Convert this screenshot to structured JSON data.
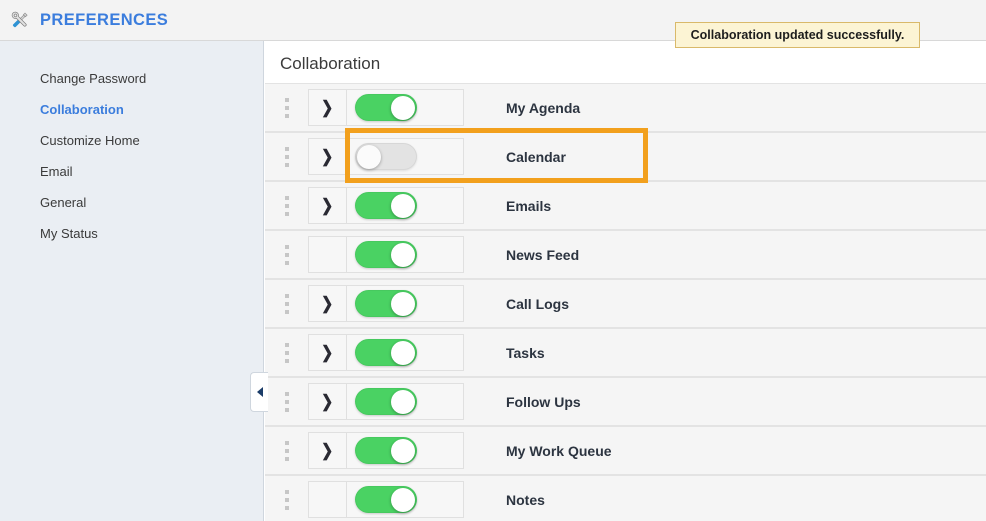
{
  "header": {
    "title": "PREFERENCES",
    "icon": "tools-icon"
  },
  "toast": {
    "message": "Collaboration updated successfully.",
    "background": "#fcf4d4",
    "border_color": "#d9b96a"
  },
  "sidebar": {
    "items": [
      {
        "label": "Change Password",
        "active": false
      },
      {
        "label": "Collaboration",
        "active": true
      },
      {
        "label": "Customize Home",
        "active": false
      },
      {
        "label": "Email",
        "active": false
      },
      {
        "label": "General",
        "active": false
      },
      {
        "label": "My Status",
        "active": false
      }
    ],
    "collapse_handle_icon": "chevron-left-icon"
  },
  "main": {
    "section_title": "Collaboration",
    "rows": [
      {
        "label": "My Agenda",
        "enabled": true,
        "has_expander": true,
        "highlighted": false
      },
      {
        "label": "Calendar",
        "enabled": false,
        "has_expander": true,
        "highlighted": true
      },
      {
        "label": "Emails",
        "enabled": true,
        "has_expander": true,
        "highlighted": false
      },
      {
        "label": "News Feed",
        "enabled": true,
        "has_expander": false,
        "highlighted": false
      },
      {
        "label": "Call Logs",
        "enabled": true,
        "has_expander": true,
        "highlighted": false
      },
      {
        "label": "Tasks",
        "enabled": true,
        "has_expander": true,
        "highlighted": false
      },
      {
        "label": "Follow Ups",
        "enabled": true,
        "has_expander": true,
        "highlighted": false
      },
      {
        "label": "My Work Queue",
        "enabled": true,
        "has_expander": true,
        "highlighted": false
      },
      {
        "label": "Notes",
        "enabled": true,
        "has_expander": false,
        "highlighted": false
      }
    ],
    "expander_icon": "chevron-right-icon",
    "drag_icon": "drag-handle-icon"
  },
  "colors": {
    "accent": "#3b7ddd",
    "toggle_on": "#4ad263",
    "toggle_off": "#e3e3e3",
    "highlight": "#f2a01d"
  }
}
